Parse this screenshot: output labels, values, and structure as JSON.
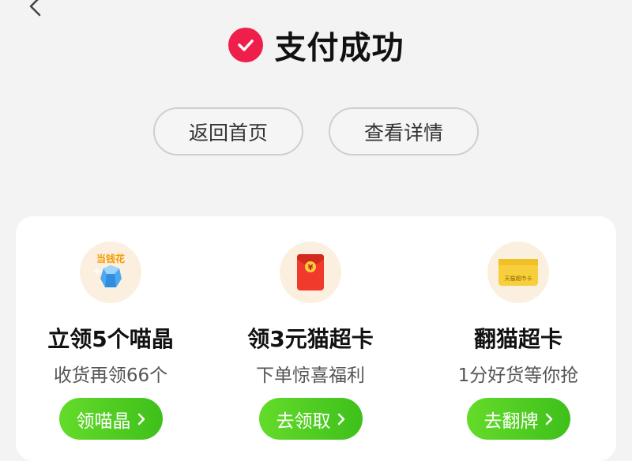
{
  "header": {
    "title": "支付成功"
  },
  "actions": {
    "home_label": "返回首页",
    "details_label": "查看详情"
  },
  "promos": [
    {
      "logo_text": "当钱花",
      "title": "立领5个喵晶",
      "subtitle": "收货再领66个",
      "button_label": "领喵晶"
    },
    {
      "envelope_text": "¥",
      "title": "领3元猫超卡",
      "subtitle": "下单惊喜福利",
      "button_label": "去领取"
    },
    {
      "card_text": "天猫超市卡",
      "title": "翻猫超卡",
      "subtitle": "1分好货等你抢",
      "button_label": "去翻牌"
    }
  ],
  "colors": {
    "accent_red": "#ee1f4a",
    "button_green": "#4fcd22"
  }
}
